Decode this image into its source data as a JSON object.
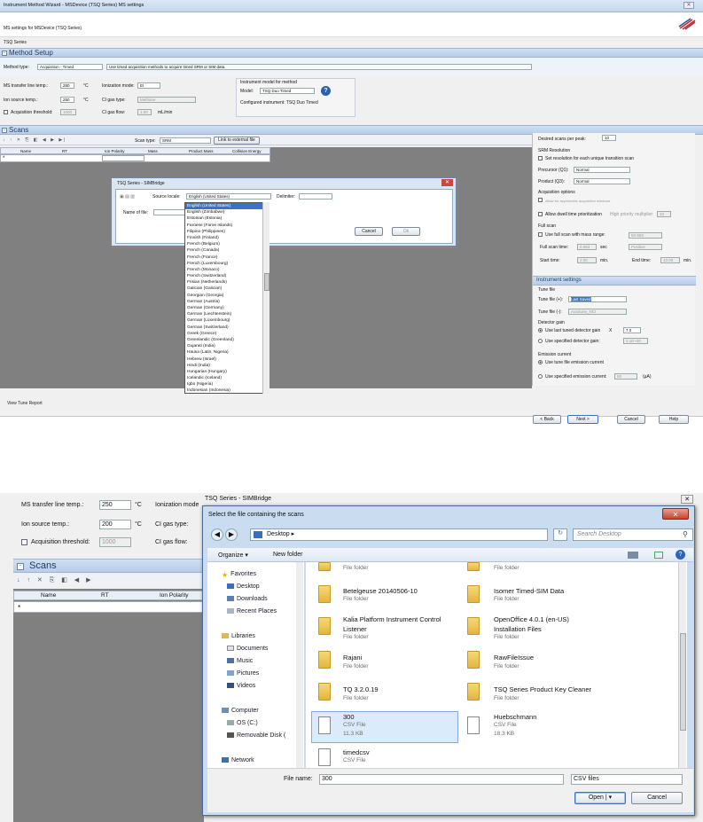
{
  "top": {
    "window_title": "Instrument Method Wizard - MSDevice (TSQ Series) MS settings",
    "window_controls": {
      "minimize": "_",
      "maximize": "□",
      "close": "✕"
    },
    "subtitle": "MS settings for MSDevice (TSQ Series)",
    "series": "TSQ Series",
    "method_setup_title": "Method Setup",
    "method_type_label": "Method type:",
    "method_type_value": "Acquisition - Timed",
    "method_type_desc": "Use timed acquisition methods to acquire timed SRM or SIM data.",
    "ms_transfer_label": "MS transfer line temp.:",
    "ms_transfer_value": "280",
    "ion_source_label": "Ion source temp.:",
    "ion_source_value": "250",
    "unit_c": "°C",
    "acq_threshold_label": "Acquisition threshold:",
    "acq_threshold_value": "1000",
    "ionization_label": "Ionization mode:",
    "ionization_value": "EI",
    "ci_gas_type_label": "CI gas type:",
    "ci_gas_type_value": "Methane",
    "ci_gas_flow_label": "CI gas flow:",
    "ci_gas_flow_value": "1.00",
    "ci_gas_flow_unit": "mL/min",
    "instrument_model_title": "Instrument model for method",
    "model_label": "Model:",
    "model_value": "TSQ Duo Timed",
    "configured_instrument": "Configured instrument: TSQ Duo Timed",
    "scans_title": "Scans",
    "scan_type_label": "Scan type:",
    "scan_type_value": "SRM",
    "link_external": "Link to external file",
    "grid_columns": [
      "Name",
      "RT",
      "Ion Polarity",
      "Mass",
      "Product Mass",
      "Collision Energy"
    ],
    "grid_row_marker": "*",
    "right": {
      "desired_scans_label": "Desired scans per peak:",
      "desired_scans_value": "10",
      "srm_resolution": "SRM Resolution",
      "set_resolution": "Set resolution for each unique transition scan",
      "precursor_label": "Precursor (Q1):",
      "precursor_value": "Normal",
      "product_label": "Product (Q3):",
      "product_value": "Normal",
      "acq_options": "Acquisition options",
      "allow_asym": "Allow for asymmetric acquisition windows",
      "allow_dwell": "Allow dwell time prioritization",
      "high_priority": "High priority multiplier:",
      "high_priority_value": "10",
      "full_scan": "Full scan",
      "use_full_scan": "Use full scan with mass range:",
      "mass_range": "50-550",
      "full_scan_time_label": "Full scan time:",
      "full_scan_time": "0.083",
      "sec": "sec",
      "polarity": "Positive",
      "start_time_label": "Start time:",
      "start_time": "2.00",
      "min": "min.",
      "end_time_label": "End time:",
      "end_time": "10.00",
      "instrument_settings": "Instrument settings",
      "tune_file": "Tune file",
      "tune_file_plus_label": "Tune file (+):",
      "tune_file_plus_value": "Last Saved",
      "tune_file_minus_label": "Tune file (-):",
      "tune_file_minus_value": "Autotune_NCI",
      "detector_gain": "Detector gain",
      "use_last_tuned": "Use last tuned detector gain",
      "x": "X",
      "gain_value": "7.0",
      "use_specified_gain": "Use specified detector gain:",
      "specified_gain_value": "2.1E+00",
      "emission_current": "Emission current",
      "use_tune_emission": "Use tune file emission current",
      "use_specified_emission": "Use specified emission current:",
      "emission_value": "50",
      "emission_unit": "(µA)"
    },
    "view_tune_report": "View Tune Report",
    "back": "< Back",
    "next": "Next >",
    "cancel": "Cancel",
    "help": "Help"
  },
  "simbridge": {
    "title": "TSQ Series - SIMBridge",
    "close": "✕",
    "source_locale_label": "Source locale:",
    "source_locale_value": "English (United States)",
    "delimiter_label": "Delimiter:",
    "name_of_file_label": "Name of file:",
    "cancel": "Cancel",
    "ok": "Ok",
    "locales": [
      "English (United States)",
      "English (Zimbabwe)",
      "Estonian (Estonia)",
      "Faroese (Faroe Islands)",
      "Filipino (Philippines)",
      "Finnish (Finland)",
      "French (Belgium)",
      "French (Canada)",
      "French (France)",
      "French (Luxembourg)",
      "French (Monaco)",
      "French (Switzerland)",
      "Frisian (Netherlands)",
      "Galician (Galician)",
      "Georgian (Georgia)",
      "German (Austria)",
      "German (Germany)",
      "German (Liechtenstein)",
      "German (Luxembourg)",
      "German (Switzerland)",
      "Greek (Greece)",
      "Greenlandic (Greenland)",
      "Gujarati (India)",
      "Hausa (Latin, Nigeria)",
      "Hebrew (Israel)",
      "Hindi (India)",
      "Hungarian (Hungary)",
      "Icelandic (Iceland)",
      "Igbo (Nigeria)",
      "Indonesian (Indonesia)"
    ]
  },
  "bottom": {
    "ms_transfer_label": "MS transfer line temp.:",
    "ms_transfer_value": "250",
    "ion_source_label": "Ion source temp.:",
    "ion_source_value": "200",
    "unit_c": "°C",
    "acq_threshold_label": "Acquisition threshold:",
    "acq_threshold_value": "1000",
    "ionization_label": "Ionization mode",
    "ci_gas_type_label": "CI gas type:",
    "ci_gas_flow_label": "CI gas flow:",
    "scans_title": "Scans",
    "grid_columns": [
      "Name",
      "RT",
      "Ion Polarity"
    ],
    "row_marker": "*",
    "simbridge_title": "TSQ Series - SIMBridge",
    "close": "✕"
  },
  "file_dialog": {
    "title": "Select the file containing the scans",
    "close": "✕",
    "location": "Desktop",
    "search_placeholder": "Search Desktop",
    "organize": "Organize ▾",
    "new_folder": "New folder",
    "nav": {
      "favorites": "Favorites",
      "desktop": "Desktop",
      "downloads": "Downloads",
      "recent_places": "Recent Places",
      "libraries": "Libraries",
      "documents": "Documents",
      "music": "Music",
      "pictures": "Pictures",
      "videos": "Videos",
      "computer": "Computer",
      "os_c": "OS (C:)",
      "removable": "Removable Disk (",
      "network": "Network"
    },
    "files": {
      "f1_type": "File folder",
      "f2_type": "File folder",
      "betel_name": "Betelgeuse 20140506-10",
      "betel_type": "File folder",
      "isomer_name": "Isomer Timed-SIM Data",
      "isomer_type": "File folder",
      "kalia_name": "Kalia Platform Instrument Control",
      "kalia_name2": "Listener",
      "kalia_type": "File folder",
      "oo_name": "OpenOffice 4.0.1 (en-US)",
      "oo_name2": "Installation Files",
      "oo_type": "File folder",
      "rajani_name": "Rajani",
      "rajani_type": "File folder",
      "raw_name": "RawFileIssue",
      "raw_type": "File folder",
      "tq_name": "TQ 3.2.0.19",
      "tq_type": "File folder",
      "tsq_name": "TSQ Series Product Key Cleaner",
      "tsq_type": "File folder",
      "f300_name": "300",
      "f300_type": "CSV File",
      "f300_size": "11.3 KB",
      "hueb_name": "Huebschmann",
      "hueb_type": "CSV File",
      "hueb_size": "18.3 KB",
      "timed_name": "timedcsv",
      "timed_type": "CSV File"
    },
    "file_name_label": "File name:",
    "file_name_value": "300",
    "filter": "CSV files",
    "open": "Open",
    "cancel": "Cancel"
  },
  "colors": {
    "accent": "#3b72c8",
    "section": "#b7cde8",
    "folder": "#e3b53f"
  }
}
